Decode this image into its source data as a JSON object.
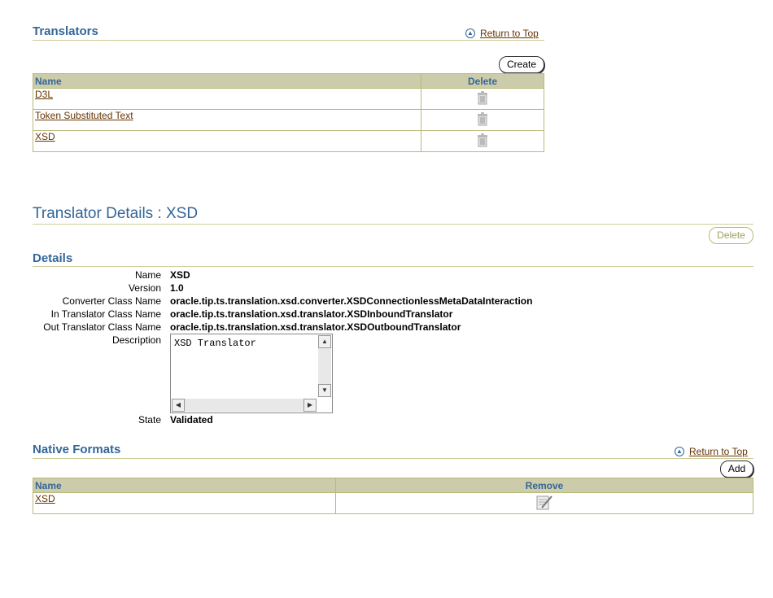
{
  "translators": {
    "title": "Translators",
    "return_to_top": "Return to Top",
    "create_label": "Create",
    "headers": {
      "name": "Name",
      "delete": "Delete"
    },
    "rows": [
      {
        "name": "D3L"
      },
      {
        "name": "Token Substituted Text"
      },
      {
        "name": "XSD"
      }
    ]
  },
  "details_page": {
    "title": "Translator Details : XSD",
    "delete_label": "Delete",
    "section_title": "Details",
    "fields": {
      "name_label": "Name",
      "name_value": "XSD",
      "version_label": "Version",
      "version_value": "1.0",
      "converter_label": "Converter Class Name",
      "converter_value": "oracle.tip.ts.translation.xsd.converter.XSDConnectionlessMetaDataInteraction",
      "in_label": "In Translator Class Name",
      "in_value": "oracle.tip.ts.translation.xsd.translator.XSDInboundTranslator",
      "out_label": "Out Translator Class Name",
      "out_value": "oracle.tip.ts.translation.xsd.translator.XSDOutboundTranslator",
      "description_label": "Description",
      "description_value": "XSD Translator",
      "state_label": "State",
      "state_value": "Validated"
    }
  },
  "native_formats": {
    "title": "Native Formats",
    "return_to_top": "Return to Top",
    "add_label": "Add",
    "headers": {
      "name": "Name",
      "remove": "Remove"
    },
    "rows": [
      {
        "name": "XSD"
      }
    ]
  }
}
